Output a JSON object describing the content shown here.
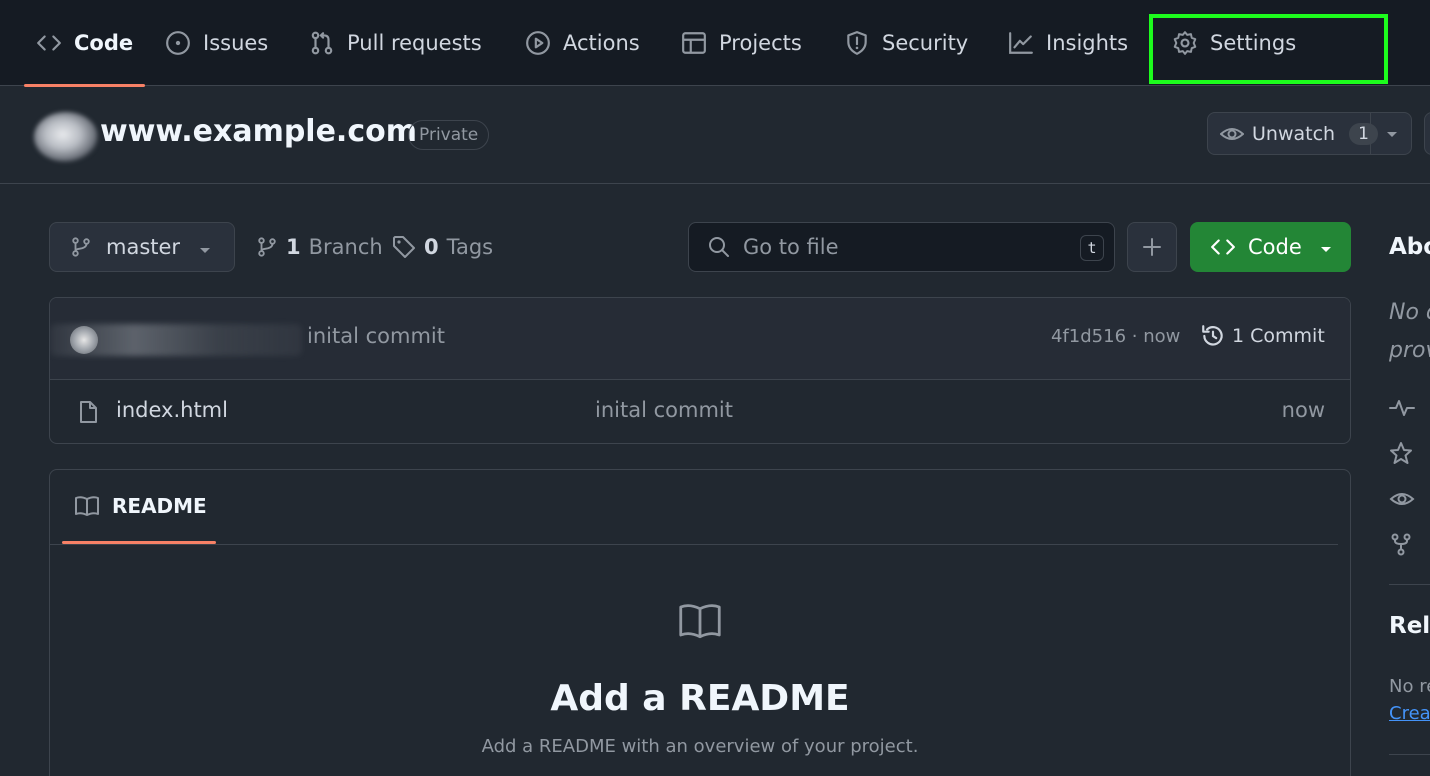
{
  "nav": {
    "tabs": [
      {
        "label": "Code",
        "icon": "code-icon",
        "active": true
      },
      {
        "label": "Issues",
        "icon": "issue-opened-icon"
      },
      {
        "label": "Pull requests",
        "icon": "git-pull-request-icon"
      },
      {
        "label": "Actions",
        "icon": "play-icon"
      },
      {
        "label": "Projects",
        "icon": "table-icon"
      },
      {
        "label": "Security",
        "icon": "shield-icon"
      },
      {
        "label": "Insights",
        "icon": "graph-icon"
      },
      {
        "label": "Settings",
        "icon": "gear-icon",
        "highlighted": true
      }
    ],
    "highlight_color": "#1dfc1d",
    "active_underline_color": "#f78166"
  },
  "repo": {
    "name": "www.example.com",
    "visibility": "Private",
    "unwatch_label": "Unwatch",
    "watch_count": "1"
  },
  "toolbar": {
    "branch": "master",
    "branch_count": "1",
    "branch_label": "Branch",
    "tag_count": "0",
    "tag_label": "Tags",
    "search_placeholder": "Go to file",
    "search_shortcut": "t",
    "code_button": "Code",
    "code_button_color": "#238636"
  },
  "latest_commit": {
    "message": "inital commit",
    "sha_time": "4f1d516 · now",
    "commits_label": "1 Commit"
  },
  "files": [
    {
      "name": "index.html",
      "message": "inital commit",
      "time": "now",
      "icon": "file-icon"
    }
  ],
  "readme": {
    "tab_label": "README",
    "title": "Add a README",
    "subtitle": "Add a README with an overview of your project."
  },
  "sidebar": {
    "about_heading": "Abo",
    "description_line1": "No d",
    "description_line2": "prov",
    "releases_heading": "Rele",
    "no_releases": "No re",
    "create_link": "Crea"
  }
}
